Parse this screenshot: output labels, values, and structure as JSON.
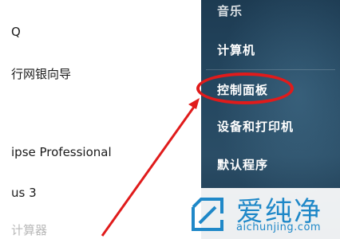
{
  "left_menu": {
    "items": [
      {
        "label": "Q"
      },
      {
        "label": "行网银向导"
      },
      {
        "label": "ipse Professional"
      },
      {
        "label": "us 3"
      },
      {
        "label": "计算器"
      }
    ]
  },
  "right_menu": {
    "items": [
      {
        "label": "音乐"
      },
      {
        "label": "计算机"
      },
      {
        "label": "控制面板"
      },
      {
        "label": "设备和打印机"
      },
      {
        "label": "默认程序"
      }
    ]
  },
  "watermark": {
    "brand": "爱纯净",
    "url": "aichunjing.com"
  },
  "colors": {
    "highlight": "#e01b1b",
    "arrow": "#e01b1b",
    "brand": "#1f88c8"
  }
}
